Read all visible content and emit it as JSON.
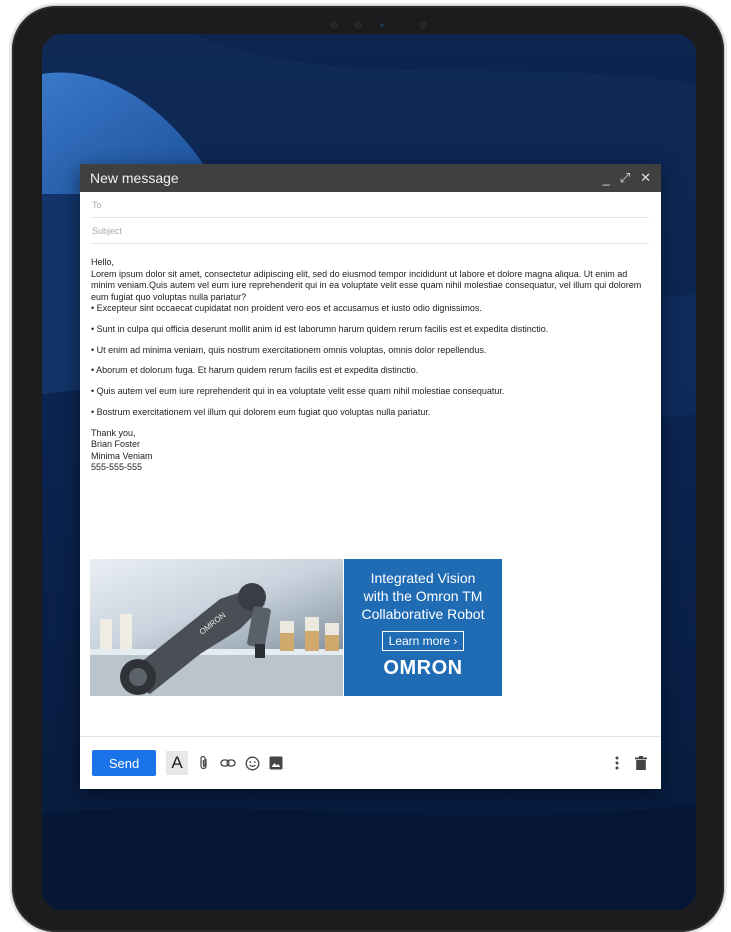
{
  "compose": {
    "title": "New message",
    "controls": {
      "minimize": "_",
      "expand": "⤢",
      "close": "✕"
    },
    "to_placeholder": "To",
    "subject_placeholder": "Subject",
    "greeting": "Hello,",
    "paragraph": "Lorem ipsum dolor sit amet, consectetur adipiscing elit, sed do eiusmod tempor incididunt ut labore et dolore magna aliqua. Ut enim ad minim veniam.Quis autem vel eum iure reprehenderit qui in ea voluptate velit esse quam nihil molestiae consequatur, vel illum qui dolorem eum fugiat quo voluptas nulla pariatur?",
    "bullets": [
      "• Excepteur sint occaecat cupidatat non proident vero eos et accusamus et iusto odio dignissimos.",
      "• Sunt in culpa qui officia deserunt mollit anim id est laborumn harum quidem rerum facilis est et expedita distinctio.",
      "• Ut enim ad minima veniam, quis nostrum exercitationem omnis voluptas, omnis dolor repellendus.",
      "• Aborum et dolorum fuga. Et harum quidem rerum facilis est et expedita distinctio.",
      "• Quis autem vel eum iure reprehenderit qui in ea voluptate velit esse quam nihil molestiae consequatur.",
      "• Bostrum exercitationem vel illum qui dolorem eum fugiat quo voluptas nulla pariatur."
    ],
    "closing": "Thank you,",
    "signature": {
      "name": "Brian Foster",
      "company": "Minima Veniam",
      "phone": "555-555-555"
    },
    "banner": {
      "headline_1": "Integrated Vision",
      "headline_2": "with the Omron TM",
      "headline_3": "Collaborative Robot",
      "cta": "Learn more ›",
      "logo": "OMRON",
      "robot_text": "OMRON",
      "ad_color": "#1f6bb4"
    },
    "footer": {
      "send_label": "Send",
      "format_label": "A",
      "icons": [
        "attach-icon",
        "link-icon",
        "emoji-icon",
        "image-icon",
        "more-icon",
        "trash-icon"
      ]
    }
  }
}
